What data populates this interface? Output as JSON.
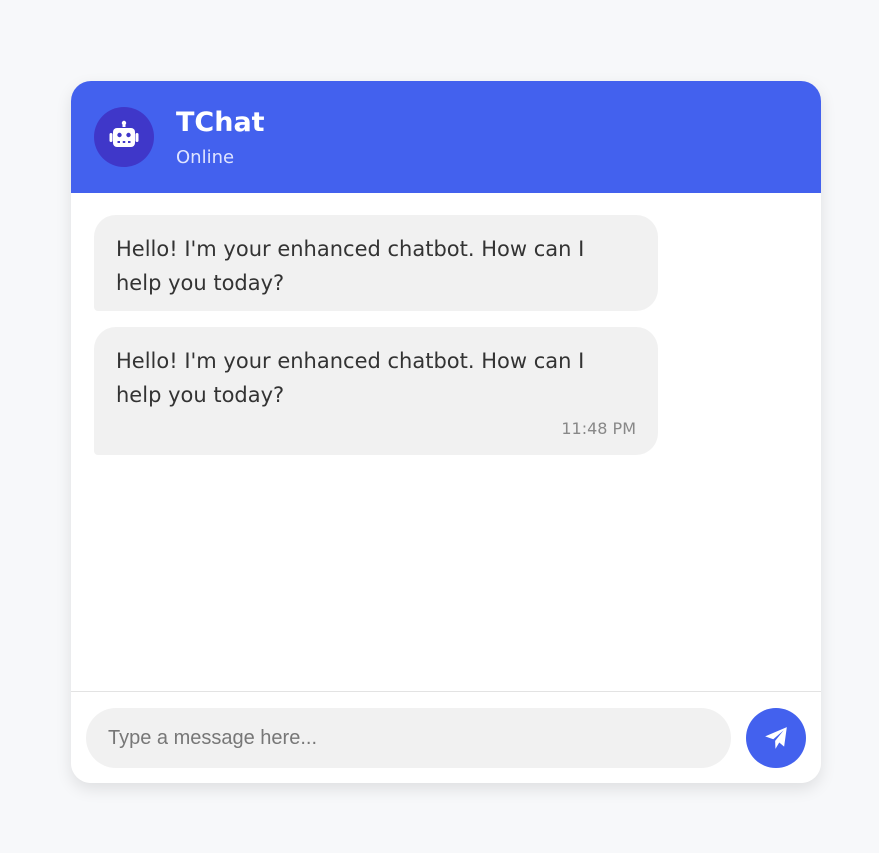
{
  "header": {
    "title": "TChat",
    "status": "Online",
    "avatar_icon": "robot-icon",
    "color": "#4361ee",
    "avatar_color": "#3f37c9"
  },
  "messages": [
    {
      "sender": "bot",
      "text": "Hello! I'm your enhanced chatbot. How can I help you today?",
      "time": ""
    },
    {
      "sender": "bot",
      "text": "Hello! I'm your enhanced chatbot. How can I help you today?",
      "time": "11:48 PM"
    }
  ],
  "input": {
    "placeholder": "Type a message here...",
    "value": ""
  },
  "send_button": {
    "icon": "paper-plane-icon",
    "color": "#4361ee"
  }
}
